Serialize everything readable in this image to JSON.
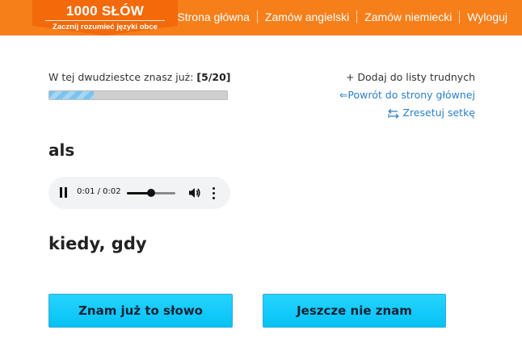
{
  "header": {
    "logo_title": "1000 SŁÓW",
    "logo_subtitle": "Zacznij rozumieć języki obce",
    "nav": [
      {
        "label": "Strona główna"
      },
      {
        "label": "Zamów angielski"
      },
      {
        "label": "Zamów niemiecki"
      },
      {
        "label": "Wyloguj"
      }
    ],
    "brand_color": "#f77f1a"
  },
  "progress": {
    "label": "W tej dwudziestce znasz już:",
    "count": "[5/20]",
    "known": 5,
    "total": 20
  },
  "links": {
    "add_difficult": "+ Dodaj do listy trudnych",
    "back_home": "⇐Powrót do strony głównej",
    "reset": "Zresetuj setkę"
  },
  "card": {
    "word": "als",
    "translation": "kiedy, gdy"
  },
  "audio": {
    "time": "0:01 / 0:02",
    "current_seconds": 1,
    "duration_seconds": 2,
    "state": "playing",
    "icons": [
      "pause-icon",
      "volume-icon",
      "more-options-icon"
    ]
  },
  "buttons": {
    "know": "Znam już to słowo",
    "dont_know": "Jeszcze nie znam",
    "button_color": "#05c2f5"
  }
}
